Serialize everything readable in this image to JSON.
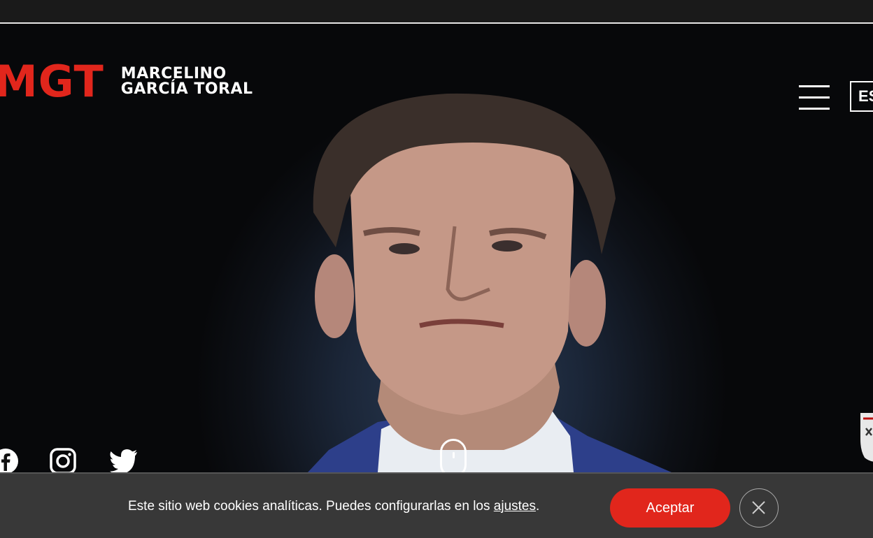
{
  "header": {
    "logo_mark": "MGT",
    "name_line1": "MARCELINO",
    "name_line2": "GARCÍA TORAL",
    "language": "ES",
    "menu_icon": "hamburger-menu-icon"
  },
  "social": [
    {
      "name": "facebook",
      "icon": "facebook-icon"
    },
    {
      "name": "instagram",
      "icon": "instagram-icon"
    },
    {
      "name": "twitter",
      "icon": "twitter-icon"
    }
  ],
  "hero": {
    "scroll_icon": "mouse-scroll-icon",
    "crest_icon": "club-crest-icon"
  },
  "cookie_banner": {
    "text": "Este sitio web cookies analíticas. Puedes configurarlas en los ",
    "settings_link": "ajustes",
    "text_end": ".",
    "accept_label": "Aceptar",
    "close_icon": "close-icon"
  },
  "colors": {
    "accent": "#e1261c",
    "banner_bg": "#383838",
    "hero_bg": "#0d1016"
  }
}
